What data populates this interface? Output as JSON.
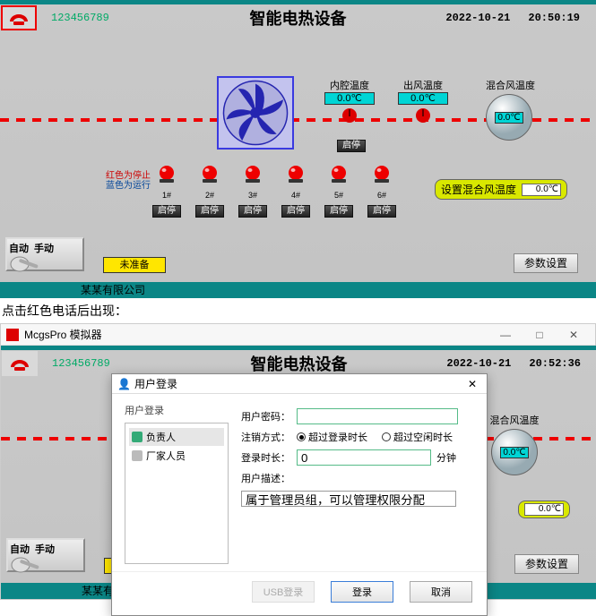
{
  "common": {
    "phone_number": "123456789",
    "title": "智能电热设备",
    "company": "某某有限公司",
    "inner_temp_label": "内腔温度",
    "outlet_temp_label": "出风温度",
    "mixed_temp_label": "混合风温度",
    "temp_value": "0.0℃",
    "fan_ss": "启停",
    "legend_red": "红色为停止",
    "legend_blue": "蓝色为运行",
    "lamps": [
      "1#",
      "2#",
      "3#",
      "4#",
      "5#",
      "6#"
    ],
    "set_mixed_label": "设置混合风温度",
    "set_mixed_value": "0.0℃",
    "mode_auto": "自动",
    "mode_manual": "手动",
    "status": "未准备",
    "param_btn": "参数设置"
  },
  "panel1": {
    "date": "2022-10-21",
    "time": "20:50:19"
  },
  "mid_text": "点击红色电话后出现：",
  "panel2": {
    "win_title": "McgsPro 模拟器",
    "date": "2022-10-21",
    "time": "20:52:36"
  },
  "dialog": {
    "title": "用户登录",
    "group_label": "用户登录",
    "roles": [
      {
        "name": "负责人",
        "selected": true
      },
      {
        "name": "厂家人员",
        "selected": false
      }
    ],
    "pwd_label": "用户密码：",
    "pwd_value": "",
    "logout_label": "注销方式：",
    "logout_opt1": "超过登录时长",
    "logout_opt2": "超过空闲时长",
    "login_time_label": "登录时长：",
    "login_time_value": "0",
    "login_time_unit": "分钟",
    "desc_label": "用户描述：",
    "desc_value": "属于管理员组，可以管理权限分配",
    "usb_btn": "USB登录",
    "login_btn": "登录",
    "cancel_btn": "取消"
  }
}
